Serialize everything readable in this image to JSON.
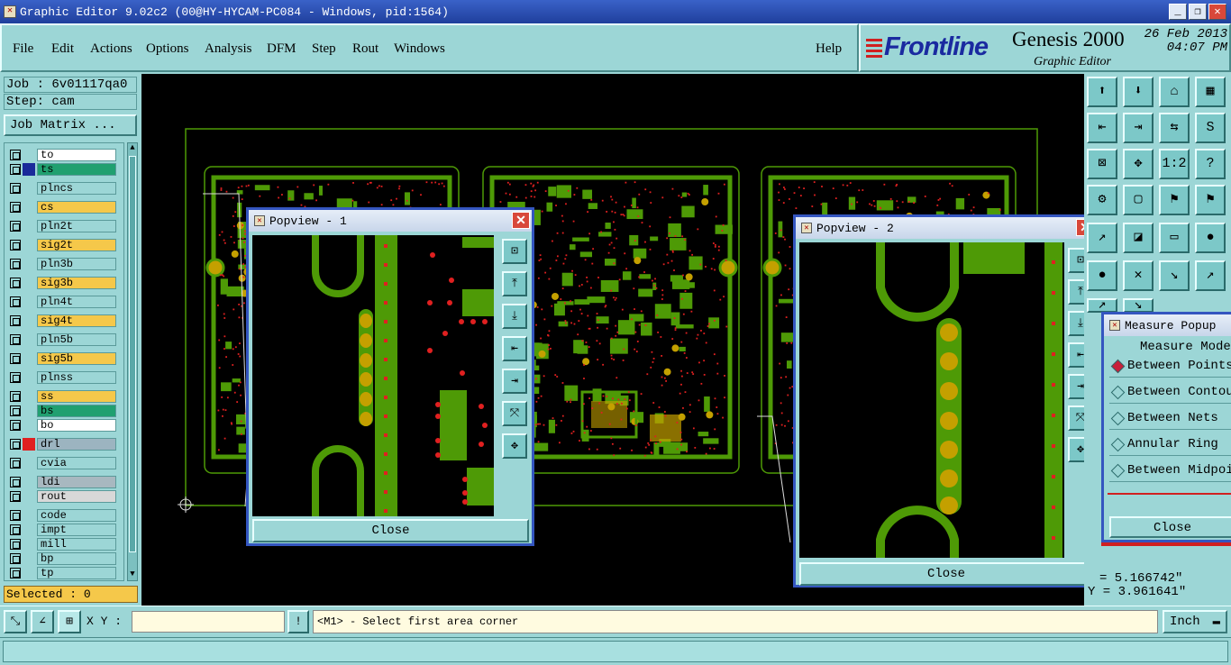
{
  "window": {
    "title": "Graphic Editor 9.02c2 (00@HY-HYCAM-PC084 - Windows, pid:1564)",
    "minimize": "_",
    "maximize": "❐",
    "close": "✕"
  },
  "menu": {
    "items": [
      "File",
      "Edit",
      "Actions",
      "Options",
      "Analysis",
      "DFM",
      "Step",
      "Rout",
      "Windows"
    ],
    "help": "Help"
  },
  "logo": {
    "brand": "Frontline",
    "product": "Genesis 2000",
    "module": "Graphic Editor",
    "date": "26 Feb 2013",
    "time": "04:07 PM"
  },
  "left": {
    "job": "Job : 6v01117qa0",
    "step": "Step: cam",
    "job_matrix": "Job Matrix ...",
    "selected": "Selected : 0",
    "layers": [
      {
        "name": "to",
        "color": "#ffffff"
      },
      {
        "name": "ts",
        "color": "#20a070",
        "active": true
      },
      {
        "name": "plncs",
        "color": "#9cd6d6"
      },
      {
        "name": "cs",
        "color": "#f5c84a"
      },
      {
        "name": "pln2t",
        "color": "#9cd6d6"
      },
      {
        "name": "sig2t",
        "color": "#f5c84a"
      },
      {
        "name": "pln3b",
        "color": "#9cd6d6"
      },
      {
        "name": "sig3b",
        "color": "#f5c84a"
      },
      {
        "name": "pln4t",
        "color": "#9cd6d6"
      },
      {
        "name": "sig4t",
        "color": "#f5c84a"
      },
      {
        "name": "pln5b",
        "color": "#9cd6d6"
      },
      {
        "name": "sig5b",
        "color": "#f5c84a"
      },
      {
        "name": "plnss",
        "color": "#9cd6d6"
      },
      {
        "name": "ss",
        "color": "#f5c84a"
      },
      {
        "name": "bs",
        "color": "#20a070"
      },
      {
        "name": "bo",
        "color": "#ffffff"
      },
      {
        "name": "drl",
        "color": "#9cb4c0",
        "swatch": "#e02020"
      },
      {
        "name": "cvia",
        "color": "#9cd6d6"
      },
      {
        "name": "ldi",
        "color": "#a8b8c0"
      },
      {
        "name": "rout",
        "color": "#d8d8d8"
      },
      {
        "name": "code",
        "color": "#9cd6d6"
      },
      {
        "name": "impt",
        "color": "#9cd6d6"
      },
      {
        "name": "mill",
        "color": "#9cd6d6"
      },
      {
        "name": "bp",
        "color": "#9cd6d6"
      },
      {
        "name": "tp",
        "color": "#9cd6d6"
      }
    ]
  },
  "popview1": {
    "title": "Popview - 1",
    "close": "Close"
  },
  "popview2": {
    "title": "Popview - 2",
    "close": "Close"
  },
  "measure": {
    "title": "Measure Popup",
    "mode_label": "Measure Mode",
    "options": [
      "Between Points",
      "Between Contours",
      "Between Nets",
      "Annular Ring",
      "Between Midpoints"
    ],
    "close": "Close"
  },
  "coords": {
    "x": "= 5.166742\"",
    "y": "Y = 3.961641\""
  },
  "bottom": {
    "xy_label": "X Y :",
    "xy_value": "",
    "prompt": "<M1> - Select first area corner",
    "units": "Inch"
  },
  "colors": {
    "copper": "#4e9a06",
    "pad": "#c4a000",
    "drill": "#e02020",
    "background": "#000000",
    "panel": "#9cd6d6"
  }
}
